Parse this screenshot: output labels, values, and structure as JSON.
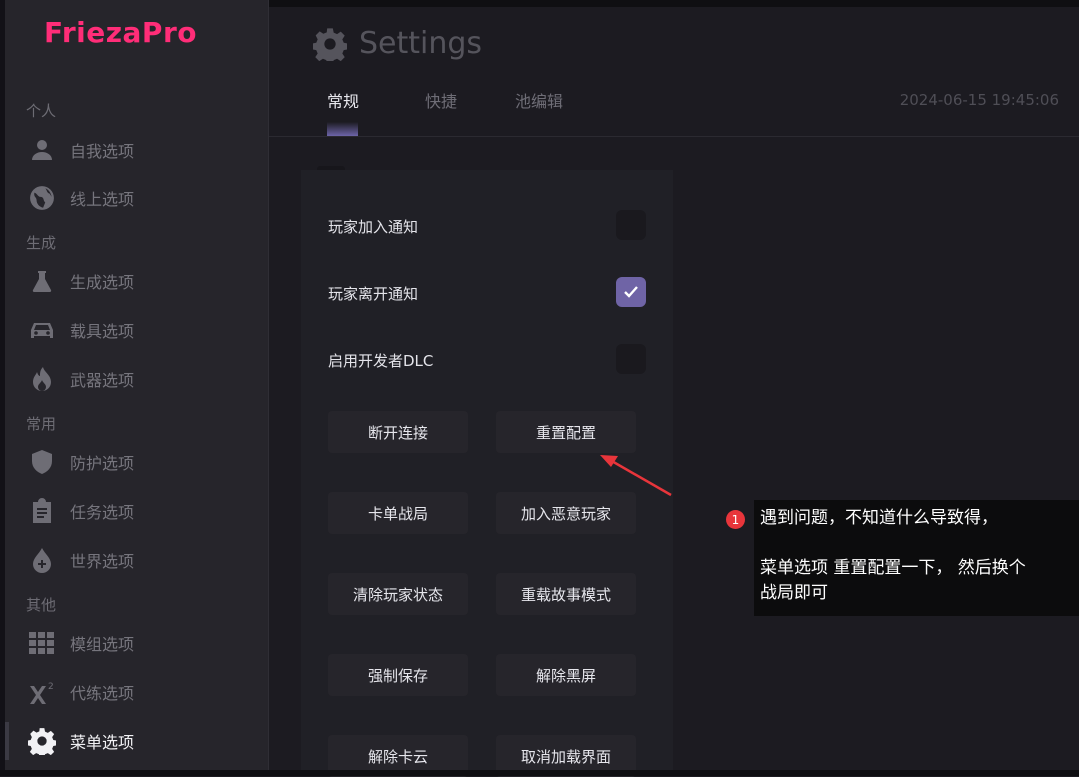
{
  "app": {
    "brand": "FriezaPro",
    "title": "Settings",
    "datetime": "2024-06-15 19:45:06"
  },
  "tabs": [
    {
      "label": "常规"
    },
    {
      "label": "快捷"
    },
    {
      "label": "池编辑"
    }
  ],
  "sidebar": {
    "sections": [
      {
        "label": "个人"
      },
      {
        "label": "生成"
      },
      {
        "label": "常用"
      },
      {
        "label": "其他"
      }
    ],
    "items": [
      {
        "label": "自我选项",
        "icon": "person-icon"
      },
      {
        "label": "线上选项",
        "icon": "globe-icon"
      },
      {
        "label": "生成选项",
        "icon": "flask-icon"
      },
      {
        "label": "载具选项",
        "icon": "car-icon"
      },
      {
        "label": "武器选项",
        "icon": "fire-icon"
      },
      {
        "label": "防护选项",
        "icon": "shield-icon"
      },
      {
        "label": "任务选项",
        "icon": "clipboard-icon"
      },
      {
        "label": "世界选项",
        "icon": "drop-icon"
      },
      {
        "label": "模组选项",
        "icon": "grid-icon"
      },
      {
        "label": "代练选项",
        "icon": "superscript-icon"
      },
      {
        "label": "菜单选项",
        "icon": "gear-icon"
      }
    ],
    "active_item": "菜单选项"
  },
  "settings": {
    "toggles": [
      {
        "label": "玩家加入通知",
        "checked": false
      },
      {
        "label": "玩家离开通知",
        "checked": true
      },
      {
        "label": "启用开发者DLC",
        "checked": false
      }
    ],
    "buttons": [
      "断开连接",
      "重置配置",
      "卡单战局",
      "加入恶意玩家",
      "清除玩家状态",
      "重载故事模式",
      "强制保存",
      "解除黑屏",
      "解除卡云",
      "取消加载界面"
    ]
  },
  "annotation": {
    "badge": "1",
    "line1": "遇到问题，不知道什么导致得，",
    "line2": "菜单选项 重置配置一下， 然后换个",
    "line3": "战局即可"
  },
  "colors": {
    "brand": "#ff2d78",
    "accent": "#6f64a6",
    "note_badge": "#e8353b",
    "arrow": "#e8353b"
  }
}
